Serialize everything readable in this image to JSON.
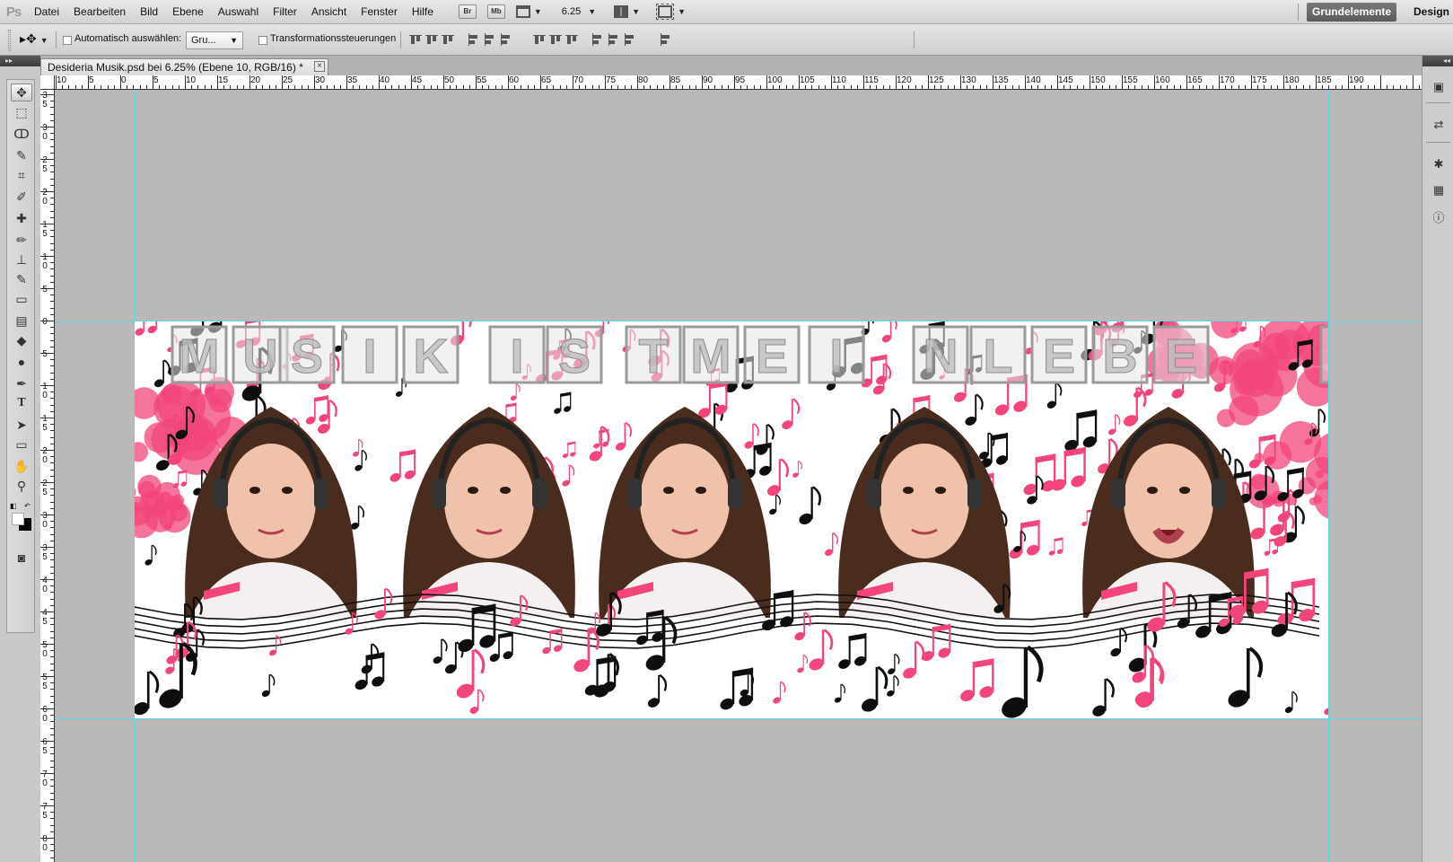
{
  "app": {
    "logo": "Ps",
    "menu": [
      "Datei",
      "Bearbeiten",
      "Bild",
      "Ebene",
      "Auswahl",
      "Filter",
      "Ansicht",
      "Fenster",
      "Hilfe"
    ],
    "bridge_label": "Br",
    "minibridge_label": "Mb",
    "zoom_value": "6.25",
    "workspaces": {
      "active": "Grundelemente",
      "other": "Design"
    }
  },
  "options": {
    "auto_select_label": "Automatisch auswählen:",
    "auto_select_value": "Gru...",
    "auto_select_checked": false,
    "transform_label": "Transformationssteuerungen",
    "transform_checked": false
  },
  "document": {
    "tab_title": "Desideria Musik.psd bei 6.25% (Ebene 10, RGB/16) *",
    "close_glyph": "×",
    "banner_text": "MUSIK IST MEIN LEBEN",
    "colors": {
      "pink": "#f2457a",
      "black": "#0e0e0e",
      "guide": "#5fd5e6"
    }
  },
  "rulers": {
    "top_labels": [
      "10",
      "5",
      "0",
      "5",
      "10",
      "15",
      "20",
      "25",
      "30",
      "35",
      "40",
      "45",
      "50",
      "55",
      "60",
      "65",
      "70",
      "75",
      "80",
      "85",
      "90",
      "95",
      "100",
      "105",
      "110",
      "115",
      "120",
      "125",
      "130",
      "135",
      "140",
      "145",
      "150",
      "155",
      "160",
      "165",
      "170",
      "175",
      "180",
      "185",
      "190"
    ],
    "left_labels": [
      "35",
      "30",
      "25",
      "20",
      "15",
      "10",
      "5",
      "0",
      "5",
      "10",
      "15",
      "20",
      "25",
      "30",
      "35",
      "40",
      "45",
      "50",
      "55",
      "60",
      "65",
      "70",
      "75",
      "80"
    ]
  },
  "tools": [
    "move-tool",
    "marquee-tool",
    "lasso-tool",
    "quick-selection-tool",
    "crop-tool",
    "eyedropper-tool",
    "healing-brush-tool",
    "brush-tool",
    "clone-stamp-tool",
    "history-brush-tool",
    "eraser-tool",
    "gradient-tool",
    "blur-tool",
    "dodge-tool",
    "pen-tool",
    "type-tool",
    "path-selection-tool",
    "shape-tool",
    "hand-tool",
    "zoom-tool"
  ],
  "dock": [
    "mini-bridge-icon",
    "history-icon",
    "navigator-icon",
    "histogram-icon",
    "info-icon"
  ]
}
